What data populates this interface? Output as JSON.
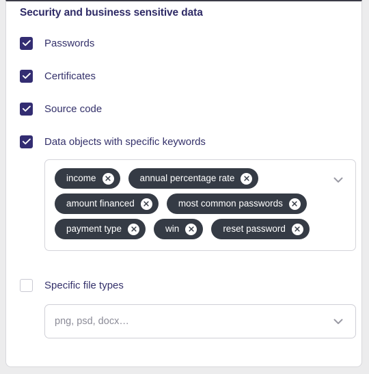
{
  "panel": {
    "title": "Security and business sensitive data"
  },
  "options": [
    {
      "label": "Passwords",
      "checked": true,
      "name": "passwords"
    },
    {
      "label": "Certificates",
      "checked": true,
      "name": "certificates"
    },
    {
      "label": "Source code",
      "checked": true,
      "name": "source-code"
    },
    {
      "label": "Data objects with specific keywords",
      "checked": true,
      "name": "data-objects-keywords"
    }
  ],
  "keyword_box": {
    "chevron_icon": "chevron-down-icon",
    "remove_icon": "close-circle-icon",
    "rows": [
      [
        {
          "label": "income"
        },
        {
          "label": "annual percentage rate"
        }
      ],
      [
        {
          "label": "amount financed"
        },
        {
          "label": "most common passwords"
        }
      ],
      [
        {
          "label": "payment type"
        },
        {
          "label": "win"
        },
        {
          "label": "reset password"
        }
      ]
    ]
  },
  "file_types": {
    "checkbox_label": "Specific file types",
    "checked": false,
    "placeholder": "png, psd, docx…",
    "chevron_icon": "chevron-down-icon"
  },
  "colors": {
    "accent": "#332d72",
    "text": "#33306a",
    "tag_bg": "#353b45",
    "placeholder": "#8b8b97",
    "border": "#d4d4da",
    "page_bg": "#ececed"
  }
}
